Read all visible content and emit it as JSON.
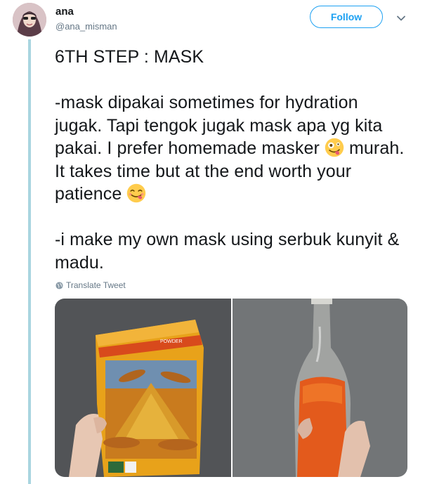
{
  "user": {
    "display_name": "ana",
    "handle": "@ana_misman"
  },
  "actions": {
    "follow_label": "Follow"
  },
  "tweet": {
    "title_line": "6TH STEP : MASK",
    "para1_part1": "-mask dipakai sometimes for hydration jugak. Tapi tengok jugak mask apa yg kita pakai. I prefer homemade masker ",
    "para1_part2": " murah. It takes time but at the end worth your patience ",
    "para2": "-i make my own mask using serbuk kunyit & madu.",
    "translate_label": "Translate Tweet"
  },
  "icons": {
    "caret": "chevron-down-icon",
    "globe": "globe-icon",
    "emoji_1": "zany-face-emoji",
    "emoji_2": "face-savoring-food-emoji"
  },
  "media": {
    "photo_1_label": "POWDER"
  },
  "colors": {
    "accent": "#1da1f2",
    "thread_line": "#a9d5e0",
    "secondary_text": "#657786",
    "primary_text": "#14171a"
  }
}
